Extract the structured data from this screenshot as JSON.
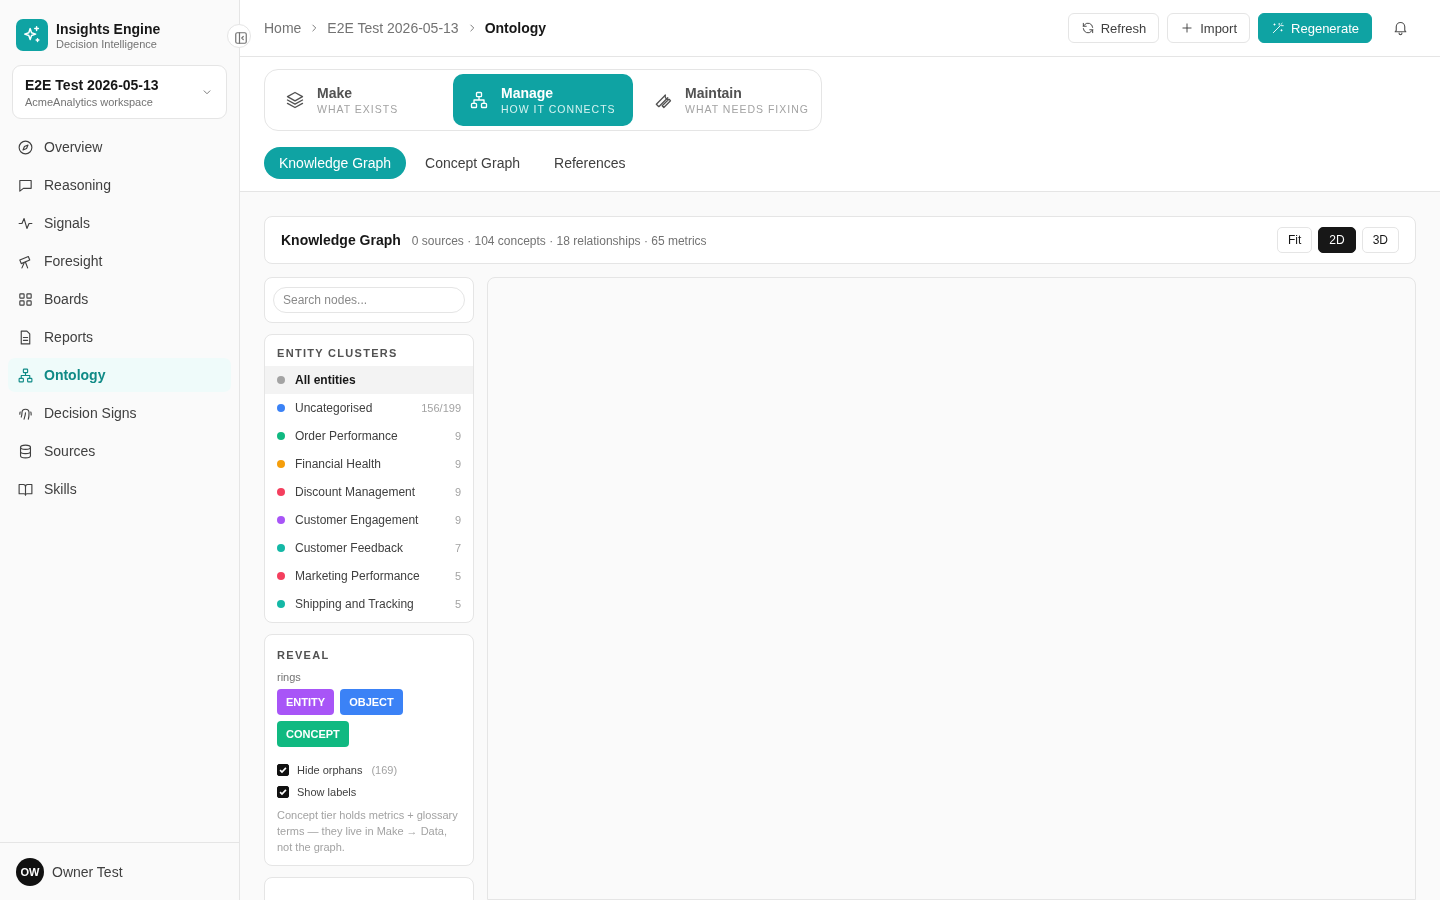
{
  "brand": {
    "title": "Insights Engine",
    "subtitle": "Decision Intelligence"
  },
  "workspace": {
    "name": "E2E Test 2026-05-13",
    "subtitle": "AcmeAnalytics workspace"
  },
  "sidebar": {
    "items": [
      {
        "label": "Overview",
        "selected": false
      },
      {
        "label": "Reasoning",
        "selected": false
      },
      {
        "label": "Signals",
        "selected": false
      },
      {
        "label": "Foresight",
        "selected": false
      },
      {
        "label": "Boards",
        "selected": false
      },
      {
        "label": "Reports",
        "selected": false
      },
      {
        "label": "Ontology",
        "selected": true
      },
      {
        "label": "Decision Signs",
        "selected": false
      },
      {
        "label": "Sources",
        "selected": false
      },
      {
        "label": "Skills",
        "selected": false
      }
    ]
  },
  "user": {
    "initials": "OW",
    "name": "Owner Test"
  },
  "breadcrumbs": [
    "Home",
    "E2E Test 2026-05-13",
    "Ontology"
  ],
  "actions": [
    {
      "label": "Refresh",
      "kind": "refresh"
    },
    {
      "label": "Import",
      "kind": "import"
    },
    {
      "label": "Regenerate",
      "kind": "primary"
    }
  ],
  "mode_tabs": [
    {
      "title": "Make",
      "subtitle": "WHAT EXISTS",
      "selected": false
    },
    {
      "title": "Manage",
      "subtitle": "HOW IT CONNECTS",
      "selected": true
    },
    {
      "title": "Maintain",
      "subtitle": "WHAT NEEDS FIXING",
      "selected": false
    }
  ],
  "sub_tabs": [
    {
      "label": "Knowledge Graph",
      "selected": true
    },
    {
      "label": "Concept Graph",
      "selected": false
    },
    {
      "label": "References",
      "selected": false
    }
  ],
  "graph_header": {
    "title": "Knowledge Graph",
    "stats": "0 sources · 104 concepts · 18 relationships · 65 metrics",
    "view_buttons": [
      {
        "label": "Fit",
        "selected": false
      },
      {
        "label": "2D",
        "selected": true
      },
      {
        "label": "3D",
        "selected": false
      }
    ]
  },
  "search": {
    "placeholder": "Search nodes..."
  },
  "clusters": {
    "title": "ENTITY CLUSTERS",
    "items": [
      {
        "label": "All entities",
        "color": "#a3a3a3",
        "selected": true
      },
      {
        "label": "Uncategorised",
        "count": "156/199",
        "color": "#3b82f6",
        "selected": false
      },
      {
        "label": "Order Performance",
        "count": "9",
        "color": "#10b981",
        "selected": false
      },
      {
        "label": "Financial Health",
        "count": "9",
        "color": "#f59e0b",
        "selected": false
      },
      {
        "label": "Discount Management",
        "count": "9",
        "color": "#f43f5e",
        "selected": false
      },
      {
        "label": "Customer Engagement",
        "count": "9",
        "color": "#a855f7",
        "selected": false
      },
      {
        "label": "Customer Feedback",
        "count": "7",
        "color": "#14b8a6",
        "selected": false
      },
      {
        "label": "Marketing Performance",
        "count": "5",
        "color": "#f43f5e",
        "selected": false
      },
      {
        "label": "Shipping and Tracking",
        "count": "5",
        "color": "#14b8a6",
        "selected": false
      }
    ]
  },
  "reveal": {
    "title": "REVEAL",
    "caption": "rings",
    "rings": [
      {
        "label": "ENTITY",
        "color": "#a855f7"
      },
      {
        "label": "OBJECT",
        "color": "#3b82f6"
      },
      {
        "label": "CONCEPT",
        "color": "#10b981"
      }
    ],
    "options": [
      {
        "label": "Hide orphans",
        "count": "(169)",
        "checked": true
      },
      {
        "label": "Show labels",
        "checked": true
      }
    ],
    "note": "Concept tier holds metrics + glossary terms — they live in Make → Data, not the graph."
  }
}
